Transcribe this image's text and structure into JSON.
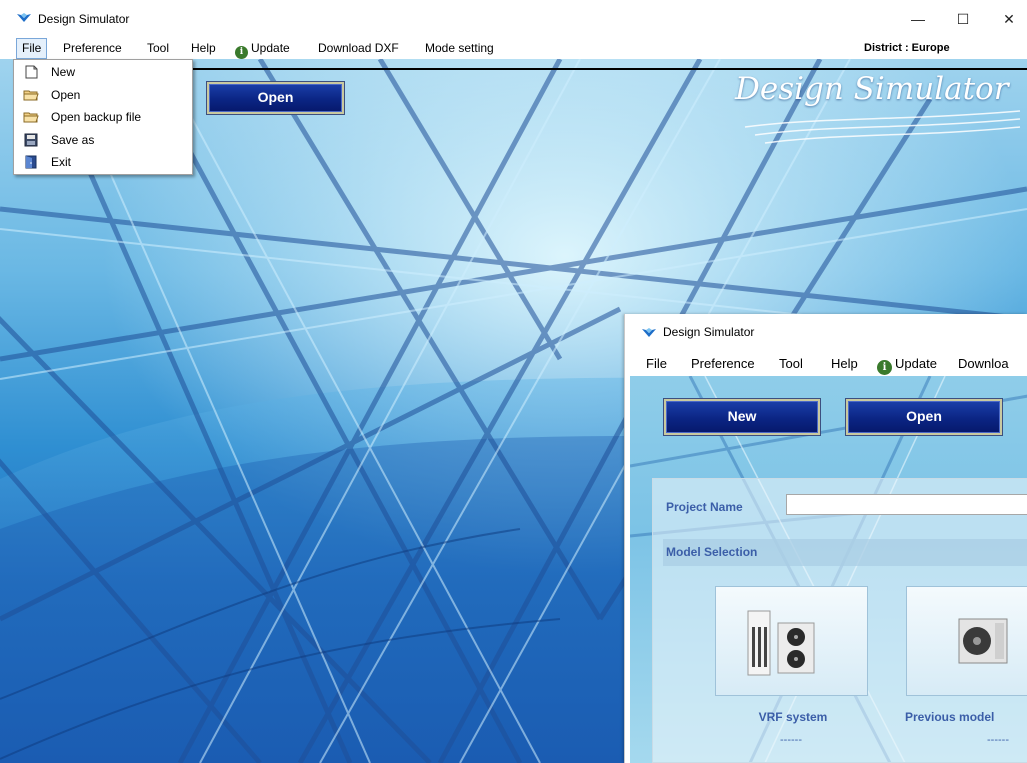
{
  "window": {
    "title": "Design Simulator",
    "minimize_glyph": "—",
    "maximize_glyph": "☐",
    "close_glyph": "✕"
  },
  "menubar": {
    "items": [
      "File",
      "Preference",
      "Tool",
      "Help",
      "Update",
      "Download DXF",
      "Mode setting"
    ],
    "district": "District : Europe"
  },
  "file_menu": {
    "items": [
      {
        "label": "New",
        "icon": "new-document-icon"
      },
      {
        "label": "Open",
        "icon": "folder-icon"
      },
      {
        "label": "Open backup file",
        "icon": "folder-icon"
      },
      {
        "label": "Save as",
        "icon": "floppy-disk-icon"
      },
      {
        "label": "Exit",
        "icon": "exit-door-icon"
      }
    ]
  },
  "main": {
    "open_button": "Open",
    "brand": "Design Simulator"
  },
  "inset": {
    "title": "Design Simulator",
    "menu": [
      "File",
      "Preference",
      "Tool",
      "Help",
      "Update",
      "Downloa"
    ],
    "new_button": "New",
    "open_button": "Open",
    "project_name_label": "Project Name",
    "model_selection_label": "Model Selection",
    "cards": [
      {
        "label": "VRF system",
        "sub": "------",
        "icon": "vrf-unit-icon"
      },
      {
        "label": "Previous model",
        "sub": "------",
        "icon": "outdoor-unit-icon"
      }
    ]
  },
  "colors": {
    "button_blue": "#0b2584",
    "label_blue": "#3b5ea8",
    "info_green": "#3a7a2c"
  }
}
